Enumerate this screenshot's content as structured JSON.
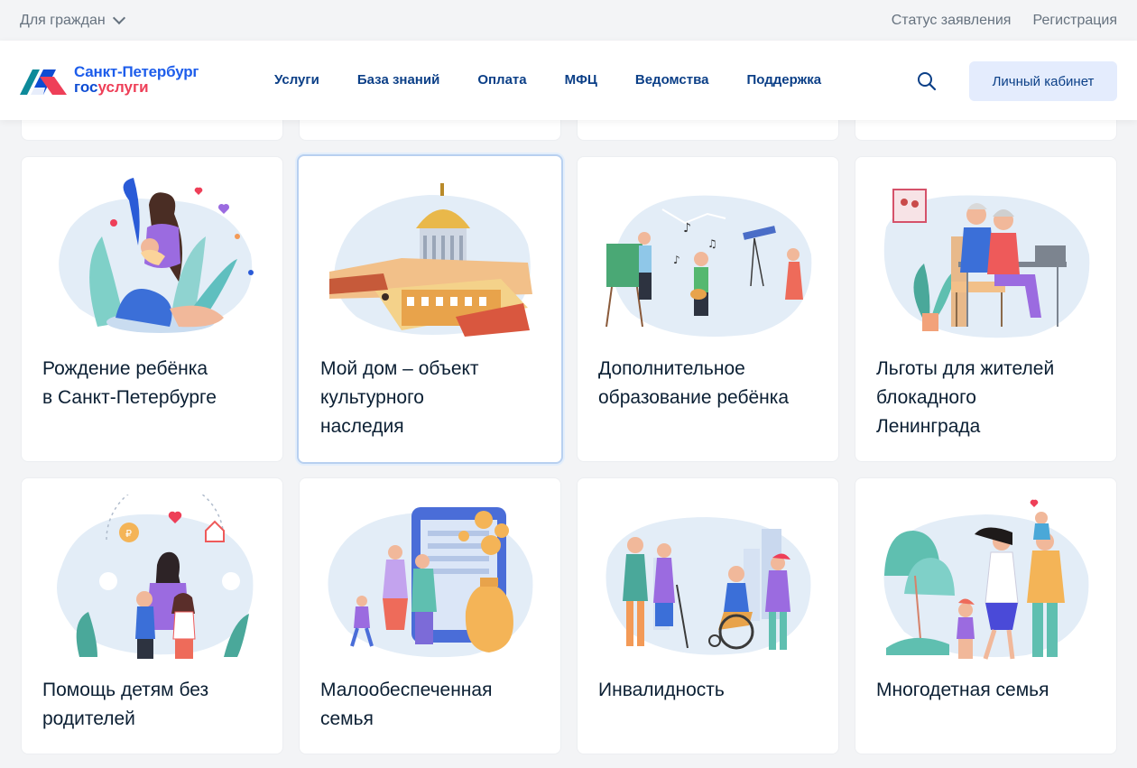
{
  "topbar": {
    "audience": "Для граждан",
    "links": [
      "Статус заявления",
      "Регистрация"
    ]
  },
  "header": {
    "logo_city": "Санкт-Петербург",
    "logo_gos": "гос",
    "logo_uslugi": "услуги",
    "nav": [
      "Услуги",
      "База знаний",
      "Оплата",
      "МФЦ",
      "Ведомства",
      "Поддержка"
    ],
    "cabinet": "Личный кабинет"
  },
  "cards": [
    {
      "line1": "Рождение ребёнка",
      "line2": "в Санкт-Петербурге",
      "line3": ""
    },
    {
      "line1": "Мой дом – объект",
      "line2": "культурного",
      "line3": "наследия"
    },
    {
      "line1": "Дополнительное",
      "line2": "образование ребёнка",
      "line3": ""
    },
    {
      "line1": "Льготы для жителей",
      "line2": "блокадного",
      "line3": "Ленинграда"
    },
    {
      "line1": "Помощь детям без",
      "line2": "родителей",
      "line3": ""
    },
    {
      "line1": "Малообеспеченная",
      "line2": "семья",
      "line3": ""
    },
    {
      "line1": "Инвалидность",
      "line2": "",
      "line3": ""
    },
    {
      "line1": "Многодетная семья",
      "line2": "",
      "line3": ""
    }
  ],
  "colors": {
    "brand_blue": "#0d4cd3",
    "brand_red": "#ee3f58",
    "nav_text": "#0b3f87",
    "button_bg": "#e4ecfd"
  }
}
